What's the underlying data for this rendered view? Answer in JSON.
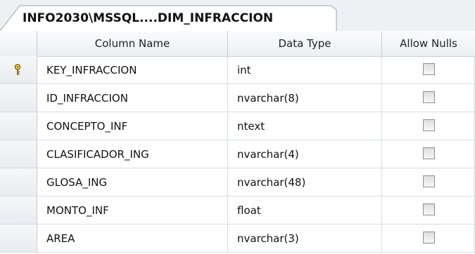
{
  "tab": {
    "title": "INFO2030\\MSSQL....DIM_INFRACCION"
  },
  "columns": {
    "name": "Column Name",
    "type": "Data Type",
    "nulls": "Allow Nulls"
  },
  "rows": [
    {
      "name": "KEY_INFRACCION",
      "type": "int",
      "allow_nulls": false,
      "primary_key": true
    },
    {
      "name": "ID_INFRACCION",
      "type": "nvarchar(8)",
      "allow_nulls": false
    },
    {
      "name": "CONCEPTO_INF",
      "type": "ntext",
      "allow_nulls": false
    },
    {
      "name": "CLASIFICADOR_ING",
      "type": "nvarchar(4)",
      "allow_nulls": false
    },
    {
      "name": "GLOSA_ING",
      "type": "nvarchar(48)",
      "allow_nulls": false
    },
    {
      "name": "MONTO_INF",
      "type": "float",
      "allow_nulls": false
    },
    {
      "name": "AREA",
      "type": "nvarchar(3)",
      "allow_nulls": false
    }
  ]
}
